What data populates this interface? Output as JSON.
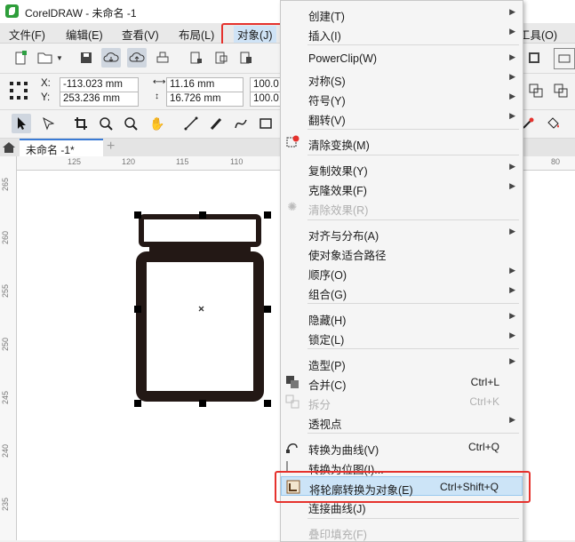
{
  "titlebar": {
    "title": "CorelDRAW - 未命名 -1"
  },
  "menubar": {
    "items": [
      {
        "label": "文件(F)"
      },
      {
        "label": "编辑(E)"
      },
      {
        "label": "查看(V)"
      },
      {
        "label": "布局(L)"
      },
      {
        "label": "对象(J)"
      },
      {
        "label": "工具(O)"
      }
    ]
  },
  "property_bar": {
    "x_label": "X:",
    "x_value": "-113.023 mm",
    "y_label": "Y:",
    "y_value": "253.236 mm",
    "w_value": "11.16 mm",
    "h_value": "16.726 mm",
    "scale_x": "100.0",
    "scale_y": "100.0"
  },
  "tabs": {
    "doc_tab": "未命名 -1*",
    "add_tab": "+"
  },
  "ruler_top": [
    "125",
    "120",
    "115",
    "110",
    "80"
  ],
  "ruler_left": [
    "265",
    "260",
    "255",
    "250",
    "245",
    "240",
    "235"
  ],
  "context_menu": {
    "items": [
      {
        "label": "创建(T)",
        "shortcut": "",
        "arrow": "▶"
      },
      {
        "label": "插入(I)",
        "shortcut": "",
        "arrow": "▶"
      },
      {
        "label": "PowerClip(W)",
        "shortcut": "",
        "arrow": "▶"
      },
      {
        "label": "对称(S)",
        "shortcut": "",
        "arrow": "▶"
      },
      {
        "label": "符号(Y)",
        "shortcut": "",
        "arrow": "▶"
      },
      {
        "label": "翻转(V)",
        "shortcut": "",
        "arrow": "▶"
      },
      {
        "label": "清除变换(M)",
        "shortcut": "",
        "arrow": ""
      },
      {
        "label": "复制效果(Y)",
        "shortcut": "",
        "arrow": "▶"
      },
      {
        "label": "克隆效果(F)",
        "shortcut": "",
        "arrow": "▶"
      },
      {
        "label": "清除效果(R)",
        "shortcut": "",
        "arrow": ""
      },
      {
        "label": "对齐与分布(A)",
        "shortcut": "",
        "arrow": "▶"
      },
      {
        "label": "使对象适合路径",
        "shortcut": "",
        "arrow": ""
      },
      {
        "label": "顺序(O)",
        "shortcut": "",
        "arrow": "▶"
      },
      {
        "label": "组合(G)",
        "shortcut": "",
        "arrow": "▶"
      },
      {
        "label": "隐藏(H)",
        "shortcut": "",
        "arrow": "▶"
      },
      {
        "label": "锁定(L)",
        "shortcut": "",
        "arrow": "▶"
      },
      {
        "label": "造型(P)",
        "shortcut": "",
        "arrow": "▶"
      },
      {
        "label": "合并(C)",
        "shortcut": "Ctrl+L",
        "arrow": ""
      },
      {
        "label": "拆分",
        "shortcut": "Ctrl+K",
        "arrow": ""
      },
      {
        "label": "透视点",
        "shortcut": "",
        "arrow": "▶"
      },
      {
        "label": "转换为曲线(V)",
        "shortcut": "Ctrl+Q",
        "arrow": ""
      },
      {
        "label": "转换为位图(I)...",
        "shortcut": "",
        "arrow": ""
      },
      {
        "label": "将轮廓转换为对象(E)",
        "shortcut": "Ctrl+Shift+Q",
        "arrow": ""
      },
      {
        "label": "连接曲线(J)",
        "shortcut": "",
        "arrow": ""
      },
      {
        "label": "叠印填充(F)",
        "shortcut": "",
        "arrow": ""
      }
    ]
  },
  "colors": {
    "highlight_border": "#e5322d",
    "menu_hover": "#cce4f7",
    "shape_stroke": "#231815"
  }
}
